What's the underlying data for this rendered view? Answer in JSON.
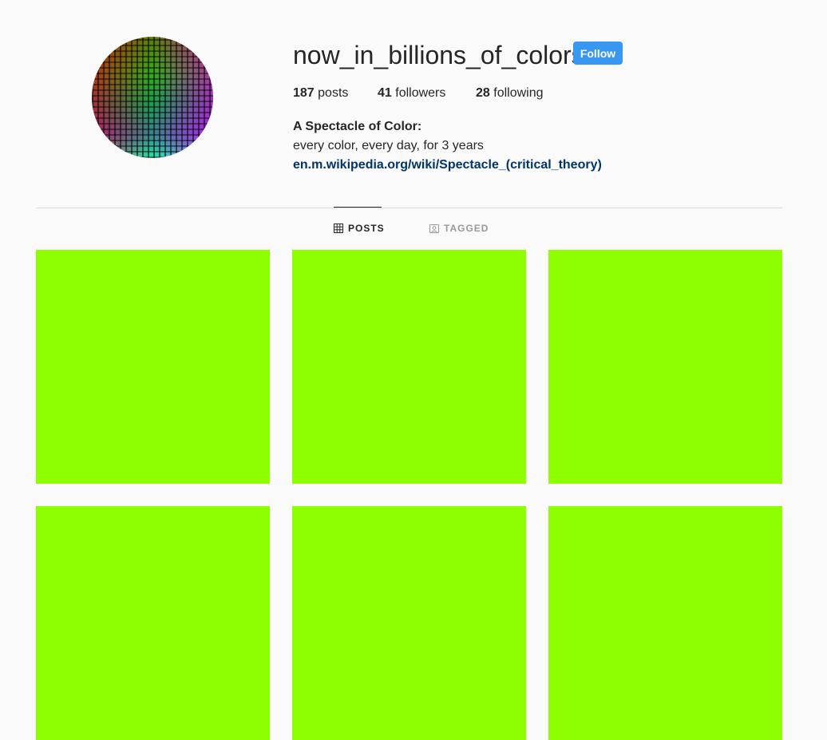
{
  "profile": {
    "username": "now_in_billions_of_colors",
    "follow_label": "Follow",
    "stats": {
      "posts_count": "187",
      "posts_label": "posts",
      "followers_count": "41",
      "followers_label": "followers",
      "following_count": "28",
      "following_label": "following"
    },
    "bio": {
      "name": "A Spectacle of Color:",
      "text": "every color, every day, for 3 years",
      "link": "en.m.wikipedia.org/wiki/Spectacle_(critical_theory)"
    }
  },
  "tabs": {
    "posts": {
      "label": "POSTS",
      "icon": "grid-icon",
      "active": true
    },
    "tagged": {
      "label": "TAGGED",
      "icon": "tagged-icon",
      "active": false
    }
  },
  "colors": {
    "accent": "#3897f0",
    "link": "#003569",
    "post_tile": "#8eff00"
  },
  "posts": [
    {
      "color": "#8eff00"
    },
    {
      "color": "#8eff00"
    },
    {
      "color": "#8eff00"
    },
    {
      "color": "#8eff00"
    },
    {
      "color": "#8eff00"
    },
    {
      "color": "#8eff00"
    }
  ]
}
